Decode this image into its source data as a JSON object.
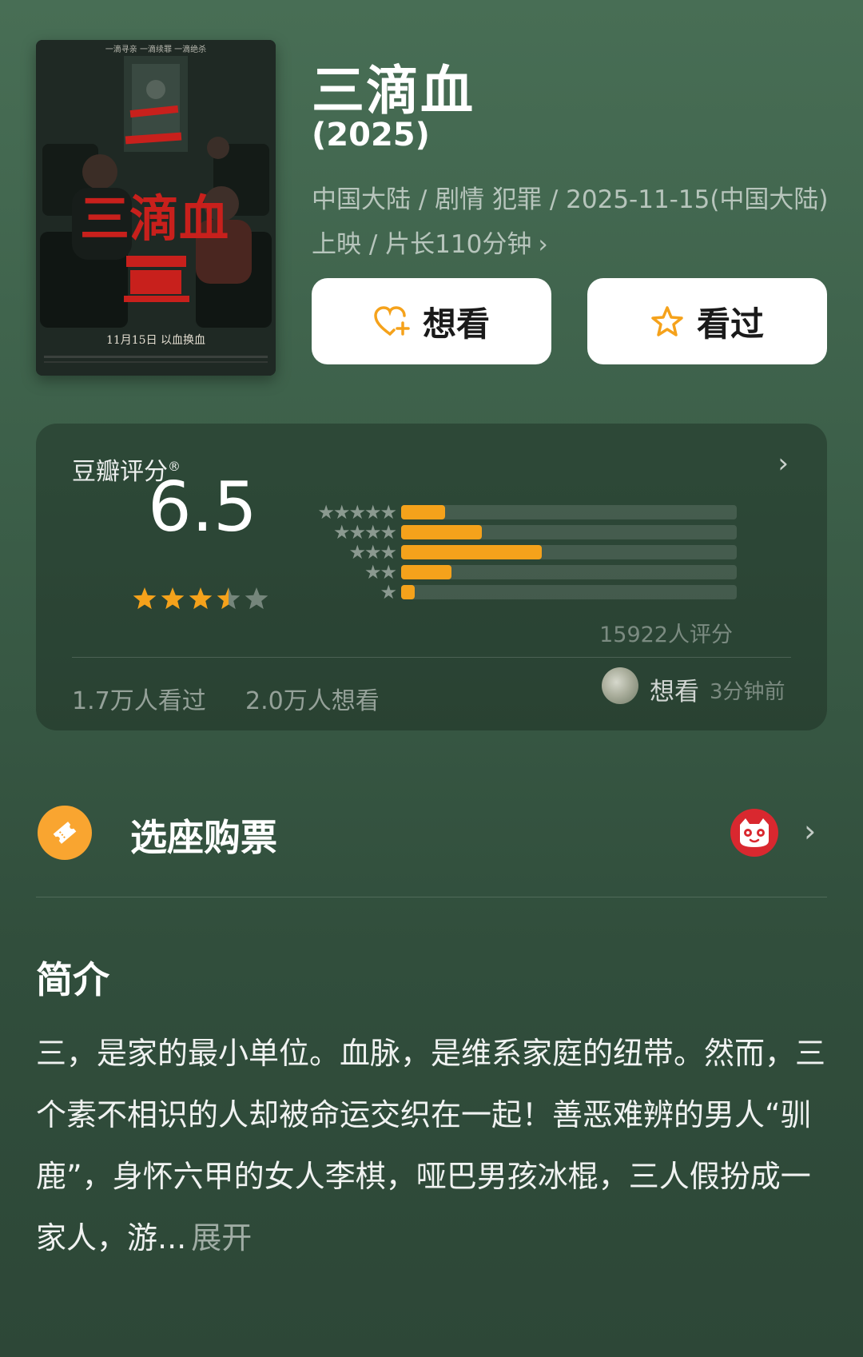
{
  "movie": {
    "title": "三滴血",
    "year": "(2025)",
    "meta_line": "中国大陆 / 剧情 犯罪 / 2025-11-15(中国大陆)上映 / 片长110分钟",
    "meta_chevron": "›",
    "poster": {
      "tagline": "一滴寻亲   一滴续罪   一滴绝杀",
      "title_text": "三滴血",
      "release_text": "11月15日 以血换血"
    }
  },
  "actions": {
    "want_label": "想看",
    "seen_label": "看过"
  },
  "rating": {
    "label": "豆瓣评分",
    "registered": "®",
    "chevron": "›",
    "score": "6.5",
    "stars_filled": 3.5,
    "stars_total": 5,
    "distribution": [
      {
        "stars": 5,
        "stars_text": "★★★★★",
        "fraction": 0.13
      },
      {
        "stars": 4,
        "stars_text": "★★★★",
        "fraction": 0.24
      },
      {
        "stars": 3,
        "stars_text": "★★★",
        "fraction": 0.42
      },
      {
        "stars": 2,
        "stars_text": "★★",
        "fraction": 0.15
      },
      {
        "stars": 1,
        "stars_text": "★",
        "fraction": 0.04
      }
    ],
    "count_text": "15922人评分",
    "seen_count": "1.7万人看过",
    "want_count": "2.0万人想看",
    "recent_activity": {
      "action": "想看",
      "time": "3分钟前"
    }
  },
  "ticket": {
    "label": "选座购票",
    "chevron": "›"
  },
  "intro": {
    "heading": "简介",
    "text": "三，是家的最小单位。血脉，是维系家庭的纽带。然而，三个素不相识的人却被命运交织在一起！善恶难辨的男人“驯鹿”，身怀六甲的女人李棋，哑巴男孩冰棍，三人假扮成一家人，游...",
    "expand_label": "展开"
  },
  "colors": {
    "accent_orange": "#f5a21b",
    "background_top": "#486e55",
    "background_bottom": "#2d4737",
    "maoyan_red": "#d9282f"
  },
  "icons": {
    "want": "heart-plus-icon",
    "seen": "star-outline-icon",
    "ticket": "ticket-icon",
    "maoyan": "cat-logo-icon"
  }
}
